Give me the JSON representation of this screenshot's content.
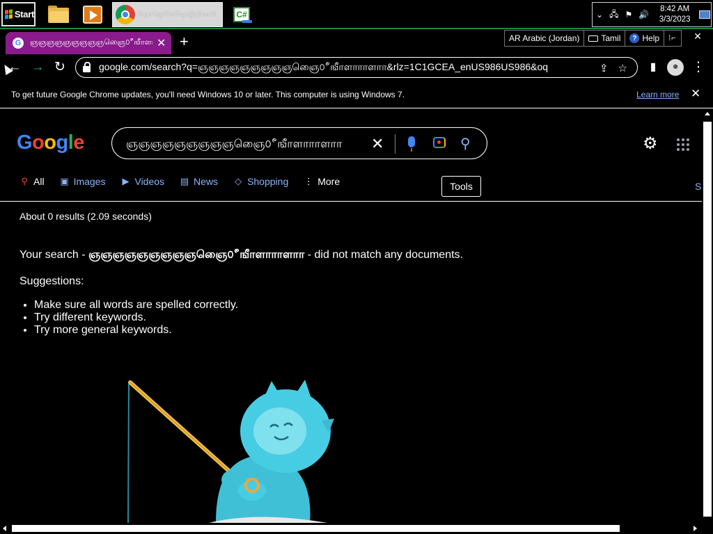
{
  "taskbar": {
    "start_label": "Start",
    "chrome_task_title": "ஞோஞெ௦ோஞெஞீஞினானோ...",
    "tray": {
      "time": "8:42 AM",
      "date": "3/3/2023"
    }
  },
  "language_bar": {
    "language": "AR Arabic (Jordan)",
    "keyboard": "Tamil",
    "help": "Help"
  },
  "browser": {
    "tab_title": "ஞஞஞஞஞஞஞஞஞஞைெ௦ீஙீாளாாாளாா",
    "url": "google.com/search?q=ஞஞஞஞஞஞஞஞஞஞைெ௦ீஙீாளாாாளாா&rlz=1C1GCEA_enUS986US986&oq...",
    "infobar_message": "To get future Google Chrome updates, you'll need Windows 10 or later. This computer is using Windows 7.",
    "infobar_link": "Learn more"
  },
  "google": {
    "logo": [
      "G",
      "o",
      "o",
      "g",
      "l",
      "e"
    ],
    "query": "ஞஞஞஞஞஞஞஞஞஞைெ௦ீஙீாளாாாளாா",
    "tabs": [
      {
        "label": "All",
        "icon": "search-icon"
      },
      {
        "label": "Images",
        "icon": "image-icon"
      },
      {
        "label": "Videos",
        "icon": "video-icon"
      },
      {
        "label": "News",
        "icon": "news-icon"
      },
      {
        "label": "Shopping",
        "icon": "tag-icon"
      },
      {
        "label": "More",
        "icon": "kebab-icon"
      }
    ],
    "tools_label": "Tools",
    "truncated_link": "S",
    "results_stats": "About 0 results (2.09 seconds)",
    "no_match": {
      "prefix": "Your search - ",
      "query": "ஞஞஞஞஞஞஞஞஞஞைெ௦ீஙீாளாாாளாா",
      "suffix": " - did not match any documents."
    },
    "suggestions_title": "Suggestions:",
    "suggestions": [
      "Make sure all words are spelled correctly.",
      "Try different keywords.",
      "Try more general keywords."
    ]
  },
  "colors": {
    "tab_active": "#8a1b8c",
    "link": "#8ab4f8",
    "taskbar_border": "#1c8a3a"
  }
}
